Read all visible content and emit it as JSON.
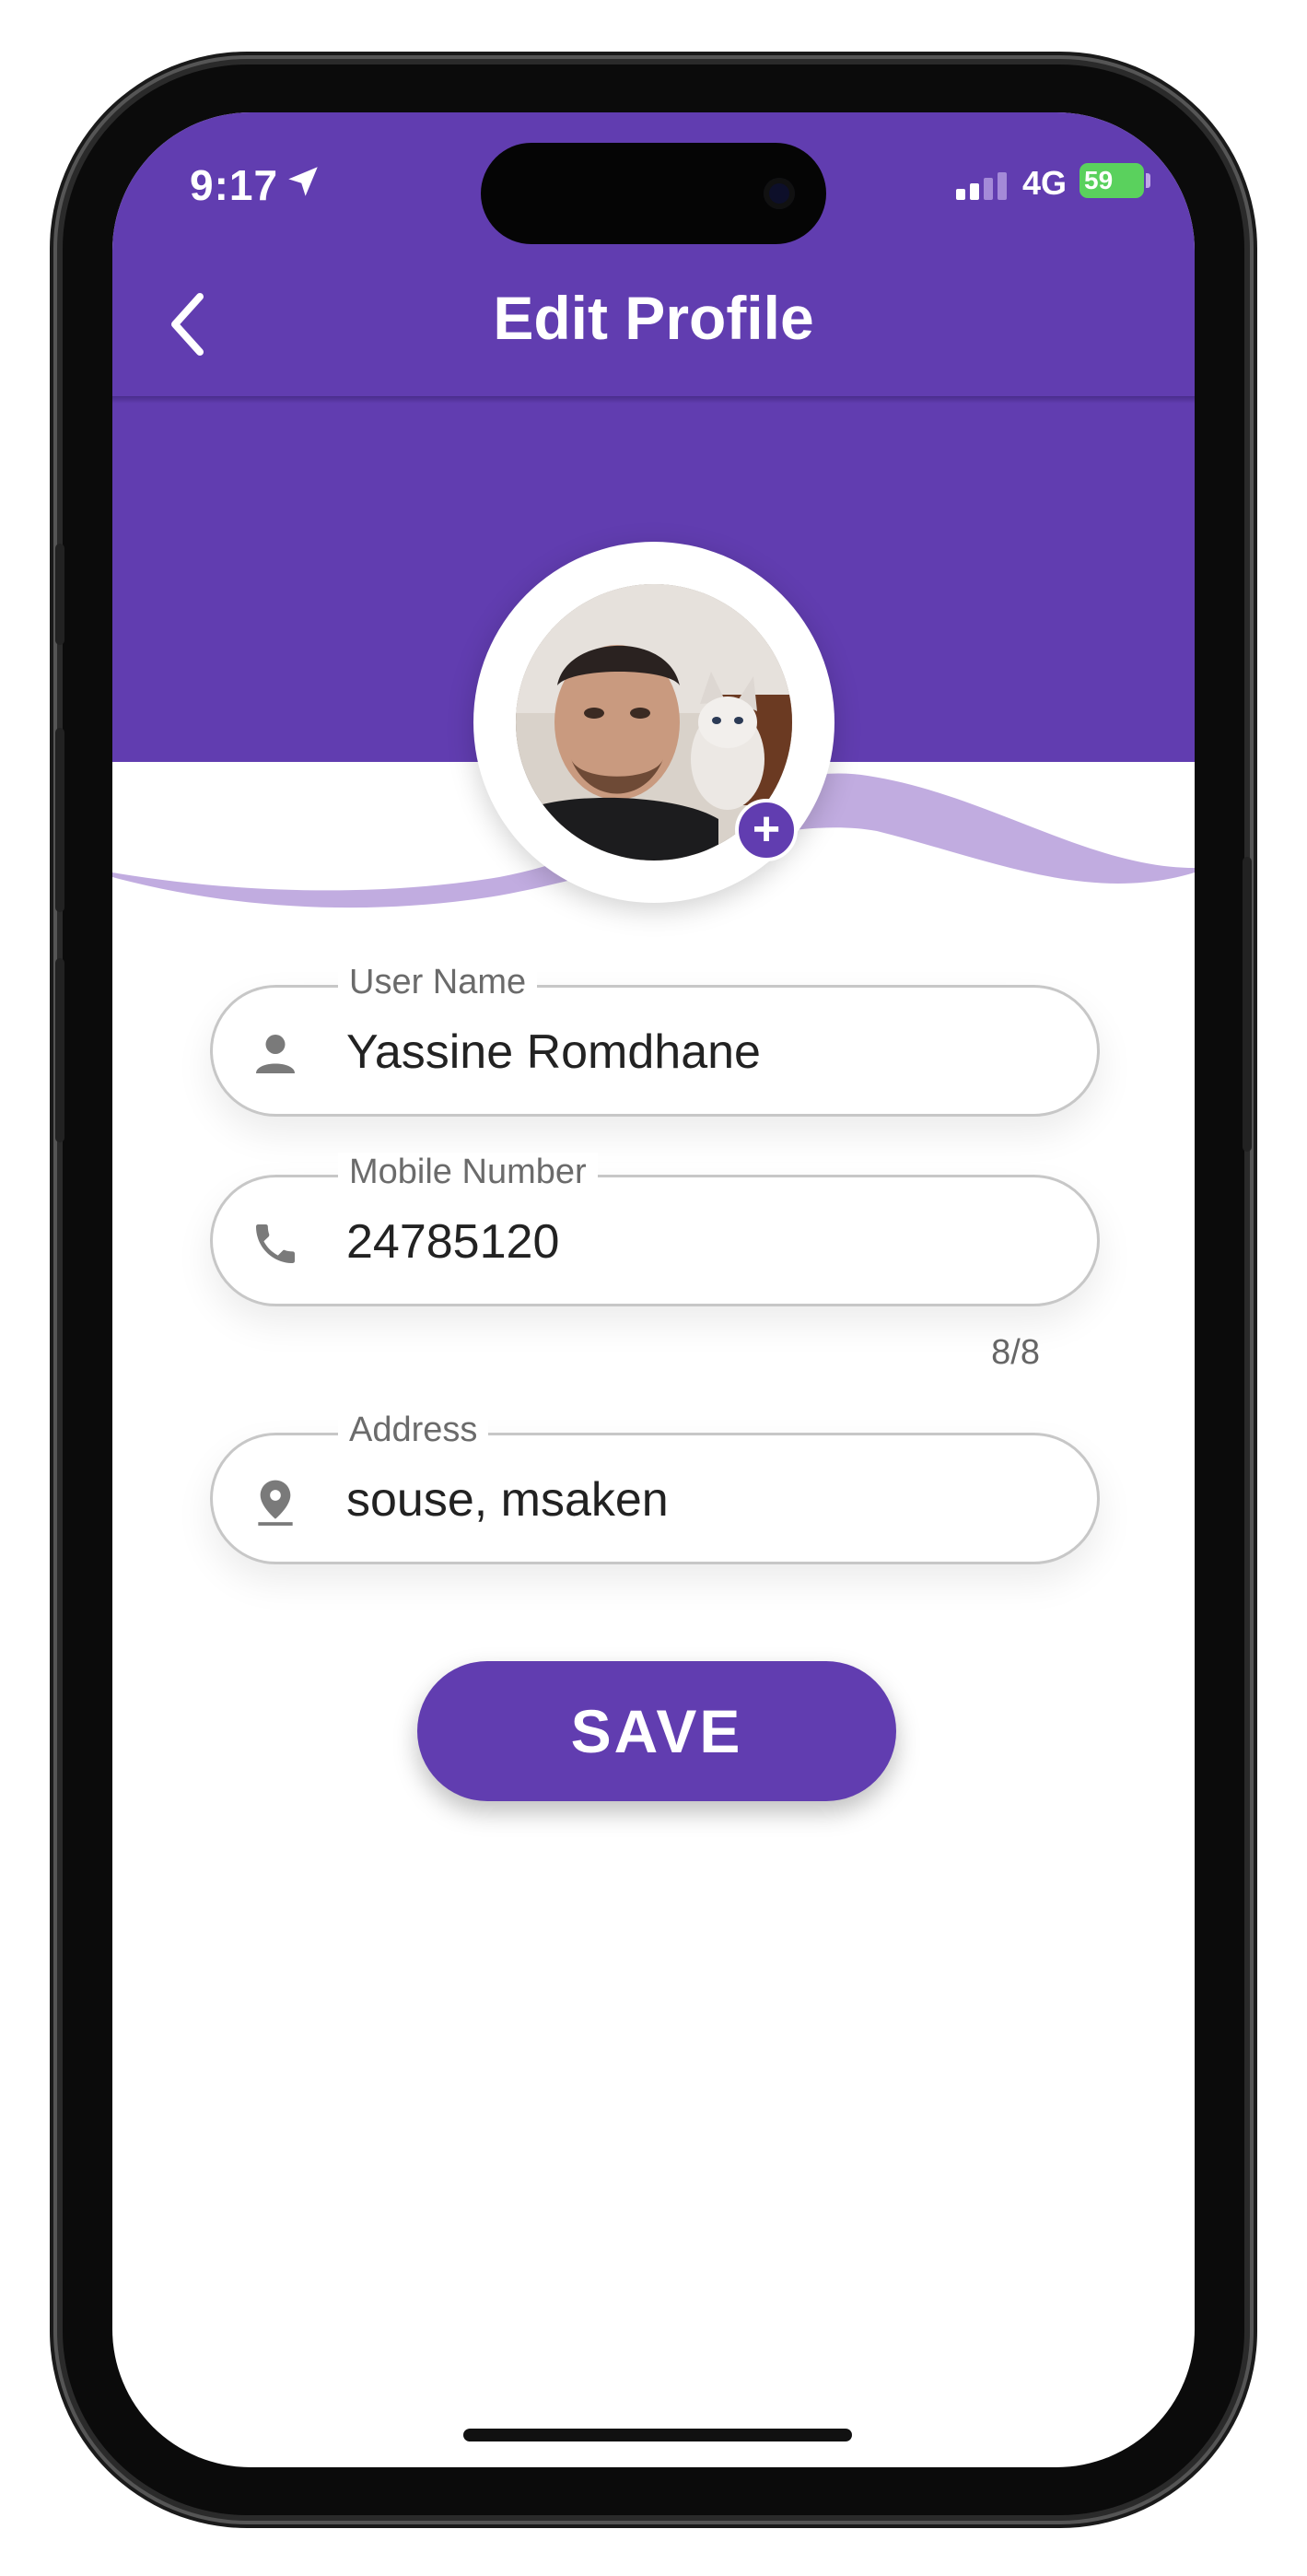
{
  "status_bar": {
    "time": "9:17",
    "network": "4G",
    "battery": "59"
  },
  "header": {
    "title": "Edit Profile"
  },
  "fields": {
    "username": {
      "label": "User Name",
      "value": "Yassine Romdhane"
    },
    "mobile": {
      "label": "Mobile Number",
      "value": "24785120",
      "counter": "8/8"
    },
    "address": {
      "label": "Address",
      "value": "souse, msaken"
    }
  },
  "actions": {
    "save_label": "SAVE"
  },
  "colors": {
    "primary": "#613db0",
    "wave_light": "#c1ace0",
    "battery": "#5ad15d"
  },
  "icons": [
    "back-chevron-icon",
    "person-icon",
    "phone-icon",
    "location-pin-icon",
    "add-photo-icon",
    "location-arrow-icon",
    "signal-icon"
  ]
}
